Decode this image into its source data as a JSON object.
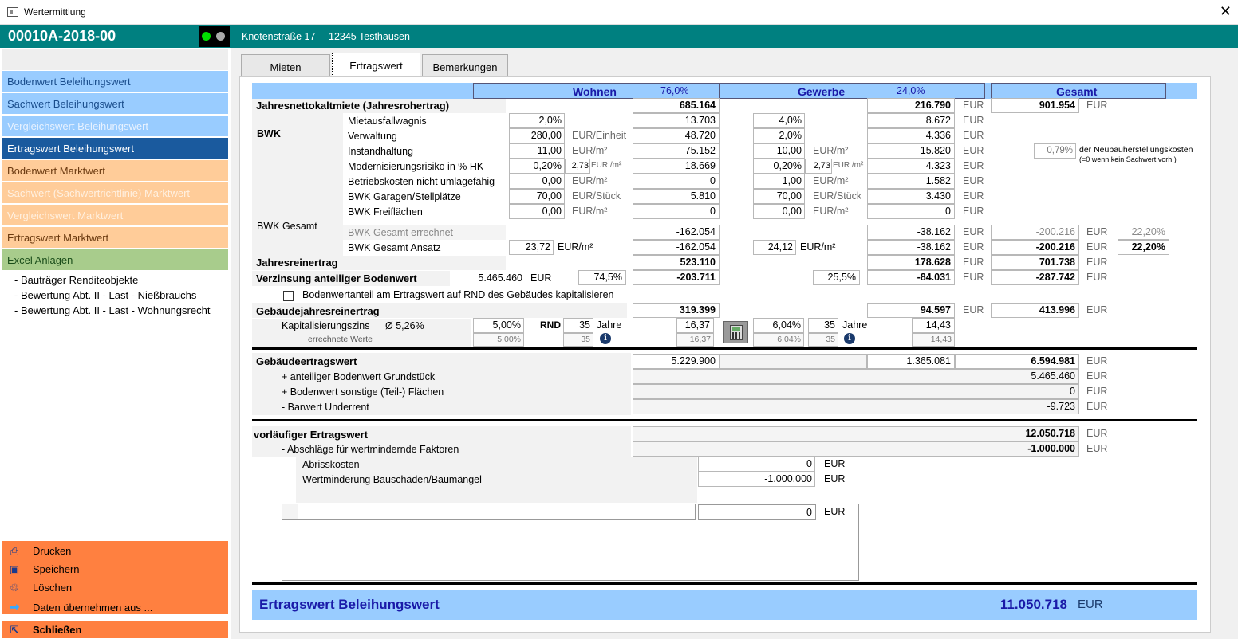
{
  "window": {
    "title": "Wertermittlung",
    "close": "✕"
  },
  "header": {
    "id": "00010A-2018-00",
    "street": "Knotenstraße 17",
    "city": "12345 Testhausen"
  },
  "sidebar": {
    "items": [
      {
        "label": "Bodenwert Beleihungswert"
      },
      {
        "label": "Sachwert Beleihungswert"
      },
      {
        "label": "Vergleichswert Beleihungswert"
      },
      {
        "label": "Ertragswert Beleihungswert"
      },
      {
        "label": "Bodenwert Marktwert"
      },
      {
        "label": "Sachwert (Sachwertrichtlinie) Marktwert"
      },
      {
        "label": "Vergleichswert Marktwert"
      },
      {
        "label": "Ertragswert Marktwert"
      },
      {
        "label": "Excel Anlagen"
      }
    ],
    "subitems": [
      "- Bauträger Renditeobjekte",
      "- Bewertung Abt. II - Last - Nießbrauchs",
      "- Bewertung Abt. II - Last - Wohnungsrecht"
    ],
    "actions": [
      {
        "label": "Drucken",
        "icon": "printer-icon"
      },
      {
        "label": "Speichern",
        "icon": "save-icon"
      },
      {
        "label": "Löschen",
        "icon": "delete-icon"
      },
      {
        "label": "Daten übernehmen aus ...",
        "icon": "arrow-right-icon"
      }
    ],
    "close_label": "Schließen"
  },
  "tabs": [
    "Mieten",
    "Ertragswert",
    "Bemerkungen"
  ],
  "cols": {
    "wohnen": "Wohnen",
    "wohnen_pct": "76,0%",
    "gewerbe": "Gewerbe",
    "gewerbe_pct": "24,0%",
    "gesamt": "Gesamt"
  },
  "eur": "EUR",
  "rows": {
    "jnkm": {
      "label": "Jahresnettokaltmiete (Jahresrohertrag)",
      "w": "685.164",
      "g": "216.790",
      "t": "901.954"
    },
    "bwk": "BWK",
    "mietausfall": {
      "label": "Mietausfallwagnis",
      "wi": "2,0%",
      "w": "13.703",
      "gi": "4,0%",
      "g": "8.672"
    },
    "verwaltung": {
      "label": "Verwaltung",
      "wi": "280,00",
      "wu": "EUR/Einheit",
      "w": "48.720",
      "gi": "2,0%",
      "g": "4.336"
    },
    "instand": {
      "label": "Instandhaltung",
      "wi": "11,00",
      "wu": "EUR/m²",
      "w": "75.152",
      "gi": "10,00",
      "gu": "EUR/m²",
      "g": "15.820",
      "pct": "0,79%",
      "note1": "der Neubauherstellungskosten",
      "note2": "(=0 wenn kein Sachwert vorh.)"
    },
    "modern": {
      "label": "Modernisierungsrisiko in % HK",
      "wi": "0,20%",
      "wi2": "2,73",
      "wu": "EUR /m²",
      "w": "18.669",
      "gi": "0,20%",
      "gi2": "2,73",
      "gu": "EUR /m²",
      "g": "4.323"
    },
    "betrieb": {
      "label": "Betriebskosten nicht umlagefähig",
      "wi": "0,00",
      "wu": "EUR/m²",
      "w": "0",
      "gi": "1,00",
      "gu": "EUR/m²",
      "g": "1.582"
    },
    "garagen": {
      "label": "BWK Garagen/Stellplätze",
      "wi": "70,00",
      "wu": "EUR/Stück",
      "w": "5.810",
      "gi": "70,00",
      "gu": "EUR/Stück",
      "g": "3.430"
    },
    "frei": {
      "label": "BWK Freiflächen",
      "wi": "0,00",
      "wu": "EUR/m²",
      "w": "0",
      "gi": "0,00",
      "gu": "EUR/m²",
      "g": "0"
    },
    "bwkges": "BWK Gesamt",
    "bwk_err": {
      "label": "BWK Gesamt errechnet",
      "w": "-162.054",
      "g": "-38.162",
      "t": "-200.216",
      "tp": "22,20%"
    },
    "bwk_ans": {
      "label": "BWK Gesamt Ansatz",
      "wi": "23,72",
      "wu": "EUR/m²",
      "w": "-162.054",
      "gi": "24,12",
      "gu": "EUR/m²",
      "g": "-38.162",
      "t": "-200.216",
      "tp": "22,20%"
    },
    "jre": {
      "label": "Jahresreinertrag",
      "w": "523.110",
      "g": "178.628",
      "t": "701.738"
    },
    "verz": {
      "label": "Verzinsung anteiliger Bodenwert",
      "bw": "5.465.460",
      "bwu": "EUR",
      "wp": "74,5%",
      "w": "-203.711",
      "gp": "25,5%",
      "g": "-84.031",
      "t": "-287.742"
    },
    "cbox": {
      "label": "Bodenwertanteil am Ertragswert auf RND des Gebäudes kapitalisieren"
    },
    "gjre": {
      "label": "Gebäudejahresreinertrag",
      "w": "319.399",
      "g": "94.597",
      "t": "413.996"
    },
    "kap": {
      "label": "Kapitalisierungszins",
      "avg": "Ø  5,26%",
      "wz": "5,00%",
      "rnd": "RND",
      "wr": "35",
      "jahre": "Jahre",
      "wf": "16,37",
      "gz": "6,04%",
      "gr": "35",
      "gf": "14,43"
    },
    "errw": {
      "label": "errechnete Werte",
      "wz": "5,00%",
      "wr": "35",
      "wf": "16,37",
      "gz": "6,04%",
      "gr": "35",
      "gf": "14,43"
    },
    "gew": {
      "label": "Gebäudeertragswert",
      "w": "5.229.900",
      "g": "1.365.081",
      "t": "6.594.981"
    },
    "antbw": {
      "label": "+ anteiliger Bodenwert Grundstück",
      "t": "5.465.460"
    },
    "bwsonst": {
      "label": "+ Bodenwert sonstige (Teil-) Flächen",
      "t": "0"
    },
    "barwert": {
      "label": "- Barwert Underrent",
      "t": "-9.723"
    },
    "vorl": {
      "label": "vorläufiger Ertragswert",
      "t": "12.050.718"
    },
    "absch": {
      "label": "- Abschläge für wertmindernde Faktoren",
      "t": "-1.000.000"
    },
    "abriss": {
      "label": "Abrisskosten",
      "v": "0"
    },
    "wertmind": {
      "label": "Wertminderung Bauschäden/Baumängel",
      "v": "-1.000.000"
    },
    "extra": {
      "v": "0"
    }
  },
  "footer": {
    "label": "Ertragswert Beleihungswert",
    "value": "11.050.718",
    "unit": "EUR"
  }
}
